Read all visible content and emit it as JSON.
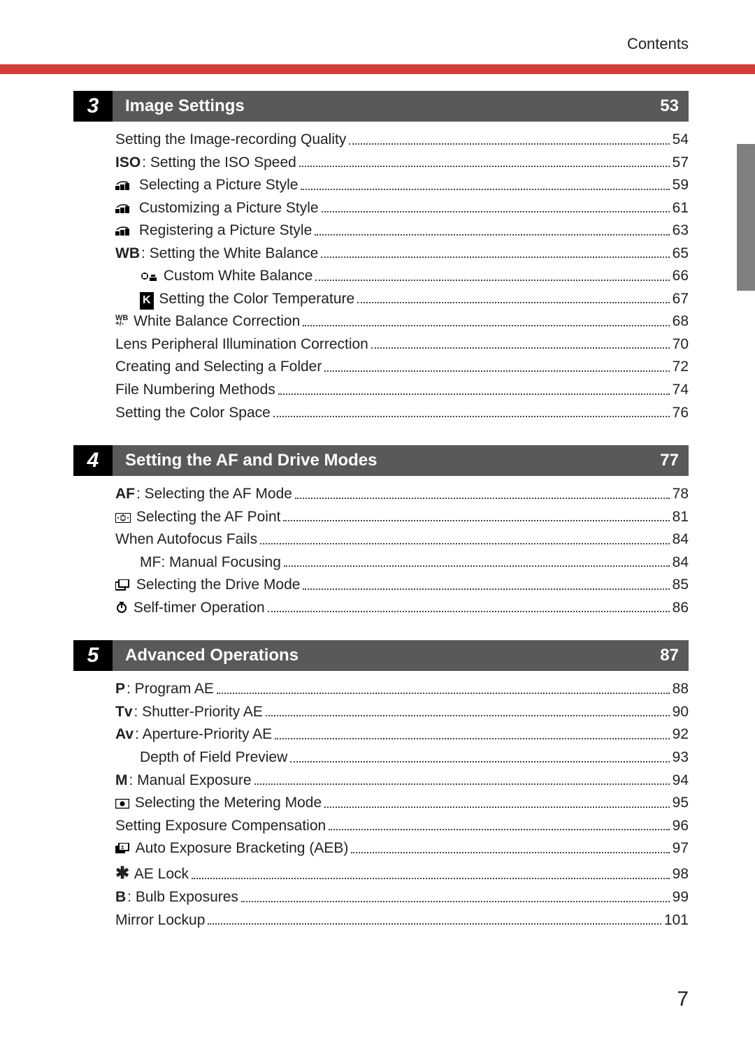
{
  "header": {
    "label": "Contents"
  },
  "page_number": "7",
  "sections": [
    {
      "number": "3",
      "title": "Image Settings",
      "page": "53",
      "items": [
        {
          "icon": null,
          "text": "Setting the Image-recording Quality",
          "page": "54",
          "indent": 0
        },
        {
          "icon": "ISO",
          "text": ": Setting the ISO Speed",
          "page": "57",
          "indent": 0
        },
        {
          "icon": "picstyle",
          "text": " Selecting a Picture Style",
          "page": "59",
          "indent": 0
        },
        {
          "icon": "picstyle",
          "text": " Customizing a Picture Style",
          "page": "61",
          "indent": 0
        },
        {
          "icon": "picstyle",
          "text": " Registering a Picture Style",
          "page": "63",
          "indent": 0
        },
        {
          "icon": "WB",
          "text": ": Setting the White Balance",
          "page": "65",
          "indent": 0
        },
        {
          "icon": "cwb",
          "text": " Custom White Balance",
          "page": "66",
          "indent": 1
        },
        {
          "icon": "K",
          "text": " Setting the Color Temperature",
          "page": "67",
          "indent": 1
        },
        {
          "icon": "wbcorr",
          "text": " White Balance Correction",
          "page": "68",
          "indent": 0
        },
        {
          "icon": null,
          "text": "Lens Peripheral Illumination Correction",
          "page": "70",
          "indent": 0
        },
        {
          "icon": null,
          "text": "Creating and Selecting a Folder",
          "page": "72",
          "indent": 0
        },
        {
          "icon": null,
          "text": "File Numbering Methods",
          "page": "74",
          "indent": 0
        },
        {
          "icon": null,
          "text": "Setting the Color Space",
          "page": "76",
          "indent": 0
        }
      ]
    },
    {
      "number": "4",
      "title": "Setting the AF and Drive Modes",
      "page": "77",
      "items": [
        {
          "icon": "AF",
          "text": ": Selecting the AF Mode",
          "page": "78",
          "indent": 0
        },
        {
          "icon": "afpoint",
          "text": " Selecting the AF Point",
          "page": "81",
          "indent": 0
        },
        {
          "icon": null,
          "text": "When Autofocus Fails",
          "page": "84",
          "indent": 0
        },
        {
          "icon": null,
          "text": "MF: Manual Focusing",
          "page": "84",
          "indent": 1
        },
        {
          "icon": "drive",
          "text": " Selecting the Drive Mode",
          "page": "85",
          "indent": 0
        },
        {
          "icon": "timer",
          "text": " Self-timer Operation",
          "page": "86",
          "indent": 0
        }
      ]
    },
    {
      "number": "5",
      "title": "Advanced Operations",
      "page": "87",
      "items": [
        {
          "icon": "P",
          "text": ": Program AE",
          "page": "88",
          "indent": 0
        },
        {
          "icon": "Tv",
          "text": ": Shutter-Priority AE",
          "page": "90",
          "indent": 0
        },
        {
          "icon": "Av",
          "text": ": Aperture-Priority AE",
          "page": "92",
          "indent": 0
        },
        {
          "icon": null,
          "text": "Depth of Field Preview",
          "page": "93",
          "indent": 1
        },
        {
          "icon": "M",
          "text": ": Manual Exposure",
          "page": "94",
          "indent": 0
        },
        {
          "icon": "meter",
          "text": " Selecting the Metering Mode",
          "page": "95",
          "indent": 0
        },
        {
          "icon": null,
          "text": "Setting Exposure Compensation",
          "page": "96",
          "indent": 0
        },
        {
          "icon": "aeb",
          "text": " Auto Exposure Bracketing (AEB)",
          "page": "97",
          "indent": 0
        },
        {
          "icon": "star",
          "text": " AE Lock",
          "page": "98",
          "indent": 0
        },
        {
          "icon": "B",
          "text": ": Bulb Exposures",
          "page": "99",
          "indent": 0
        },
        {
          "icon": null,
          "text": "Mirror Lockup",
          "page": "101",
          "indent": 0
        }
      ]
    }
  ]
}
